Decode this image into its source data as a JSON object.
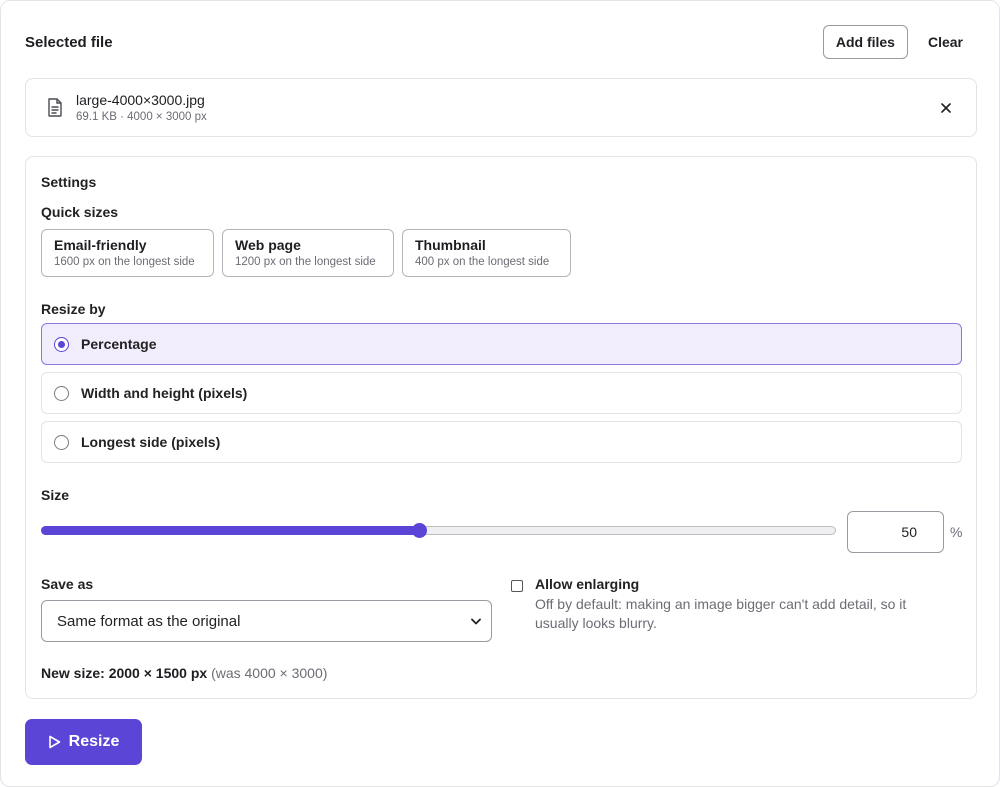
{
  "header": {
    "title": "Selected file",
    "add_files_label": "Add files",
    "clear_label": "Clear"
  },
  "file": {
    "name": "large-4000×3000.jpg",
    "meta": "69.1 KB · 4000 × 3000 px",
    "icon": "document-icon"
  },
  "settings": {
    "title": "Settings",
    "quick_sizes_label": "Quick sizes",
    "quick_sizes": [
      {
        "title": "Email-friendly",
        "subtitle": "1600 px on the longest side"
      },
      {
        "title": "Web page",
        "subtitle": "1200 px on the longest side"
      },
      {
        "title": "Thumbnail",
        "subtitle": "400 px on the longest side"
      }
    ],
    "resize_by_label": "Resize by",
    "resize_options": [
      {
        "label": "Percentage",
        "selected": true
      },
      {
        "label": "Width and height (pixels)",
        "selected": false
      },
      {
        "label": "Longest side (pixels)",
        "selected": false
      }
    ],
    "size_label": "Size",
    "size_value": "50",
    "size_unit": "%",
    "slider_fraction": 0.475,
    "save_as_label": "Save as",
    "save_as_value": "Same format as the original",
    "allow_enlarging_label": "Allow enlarging",
    "allow_enlarging_checked": false,
    "allow_enlarging_desc": "Off by default: making an image bigger can't add detail, so it usually looks blurry.",
    "new_size_label": "New size: 2000 × 1500 px",
    "new_size_was": "(was 4000 × 3000)"
  },
  "actions": {
    "resize_label": "Resize"
  },
  "colors": {
    "accent": "#5a45d6",
    "selected_bg": "#f1edfd"
  }
}
